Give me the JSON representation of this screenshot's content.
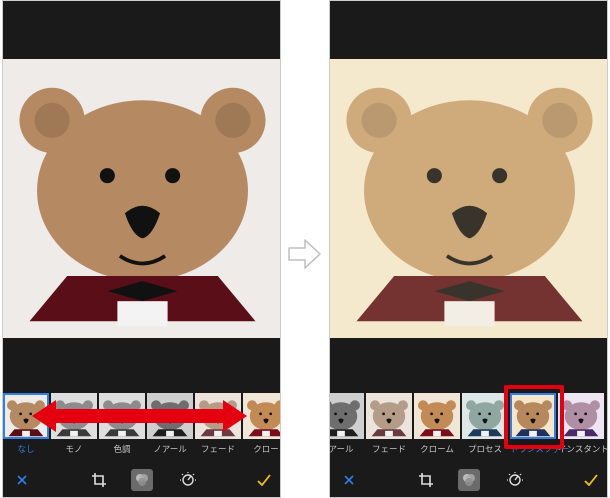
{
  "left_screen": {
    "filters": [
      {
        "label": "なし",
        "tone": "orig",
        "active": true
      },
      {
        "label": "モノ",
        "tone": "mono",
        "active": false
      },
      {
        "label": "色調",
        "tone": "mono",
        "active": false
      },
      {
        "label": "ノアール",
        "tone": "noir",
        "active": false
      },
      {
        "label": "フェード",
        "tone": "fade",
        "active": false
      },
      {
        "label": "クロー",
        "tone": "chrome",
        "active": false
      }
    ],
    "toolbar": {
      "cancel_icon": "close-icon",
      "crop_icon": "crop-icon",
      "filters_icon": "filters-icon",
      "adjust_icon": "adjust-dial-icon",
      "done_icon": "checkmark-icon"
    }
  },
  "right_screen": {
    "filters": [
      {
        "label": "アール",
        "tone": "noir",
        "active": false
      },
      {
        "label": "フェード",
        "tone": "fade",
        "active": false
      },
      {
        "label": "クローム",
        "tone": "chrome",
        "active": false
      },
      {
        "label": "プロセス",
        "tone": "process",
        "active": false
      },
      {
        "label": "トランスファー",
        "tone": "transfer",
        "active": true
      },
      {
        "label": "インスタント",
        "tone": "instant",
        "active": false
      }
    ],
    "toolbar": {
      "cancel_icon": "close-icon",
      "crop_icon": "crop-icon",
      "filters_icon": "filters-icon",
      "adjust_icon": "adjust-dial-icon",
      "done_icon": "checkmark-icon"
    }
  },
  "colors": {
    "accent_blue": "#2f7fe6",
    "done_yellow": "#f5c400",
    "highlight_red": "#e4000f",
    "background_dark": "#1a1a1a"
  },
  "transition_icon": "right-arrow-outline-icon"
}
